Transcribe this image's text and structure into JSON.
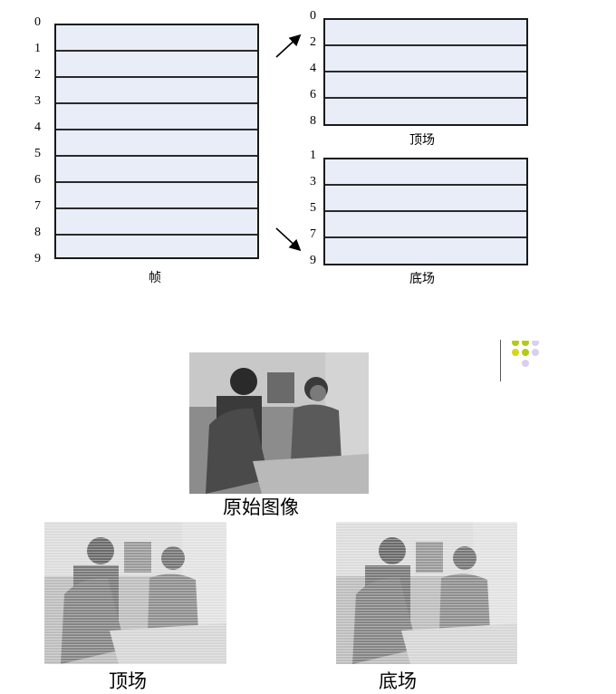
{
  "frame": {
    "row_labels": [
      "0",
      "1",
      "2",
      "3",
      "4",
      "5",
      "6",
      "7",
      "8",
      "9"
    ],
    "caption": "帧"
  },
  "top_field": {
    "row_labels": [
      "0",
      "2",
      "4",
      "6",
      "8"
    ],
    "caption": "顶场"
  },
  "bottom_field": {
    "row_labels": [
      "1",
      "3",
      "5",
      "7",
      "9"
    ],
    "caption": "底场"
  },
  "photos": {
    "original_caption": "原始图像",
    "top_caption": "顶场",
    "bottom_caption": "底场"
  },
  "colors": {
    "box_fill": "#e8edf8",
    "decor_green": "#b5c91a",
    "decor_yellow": "#d6d61c",
    "decor_lavender": "#d8d0ec"
  }
}
